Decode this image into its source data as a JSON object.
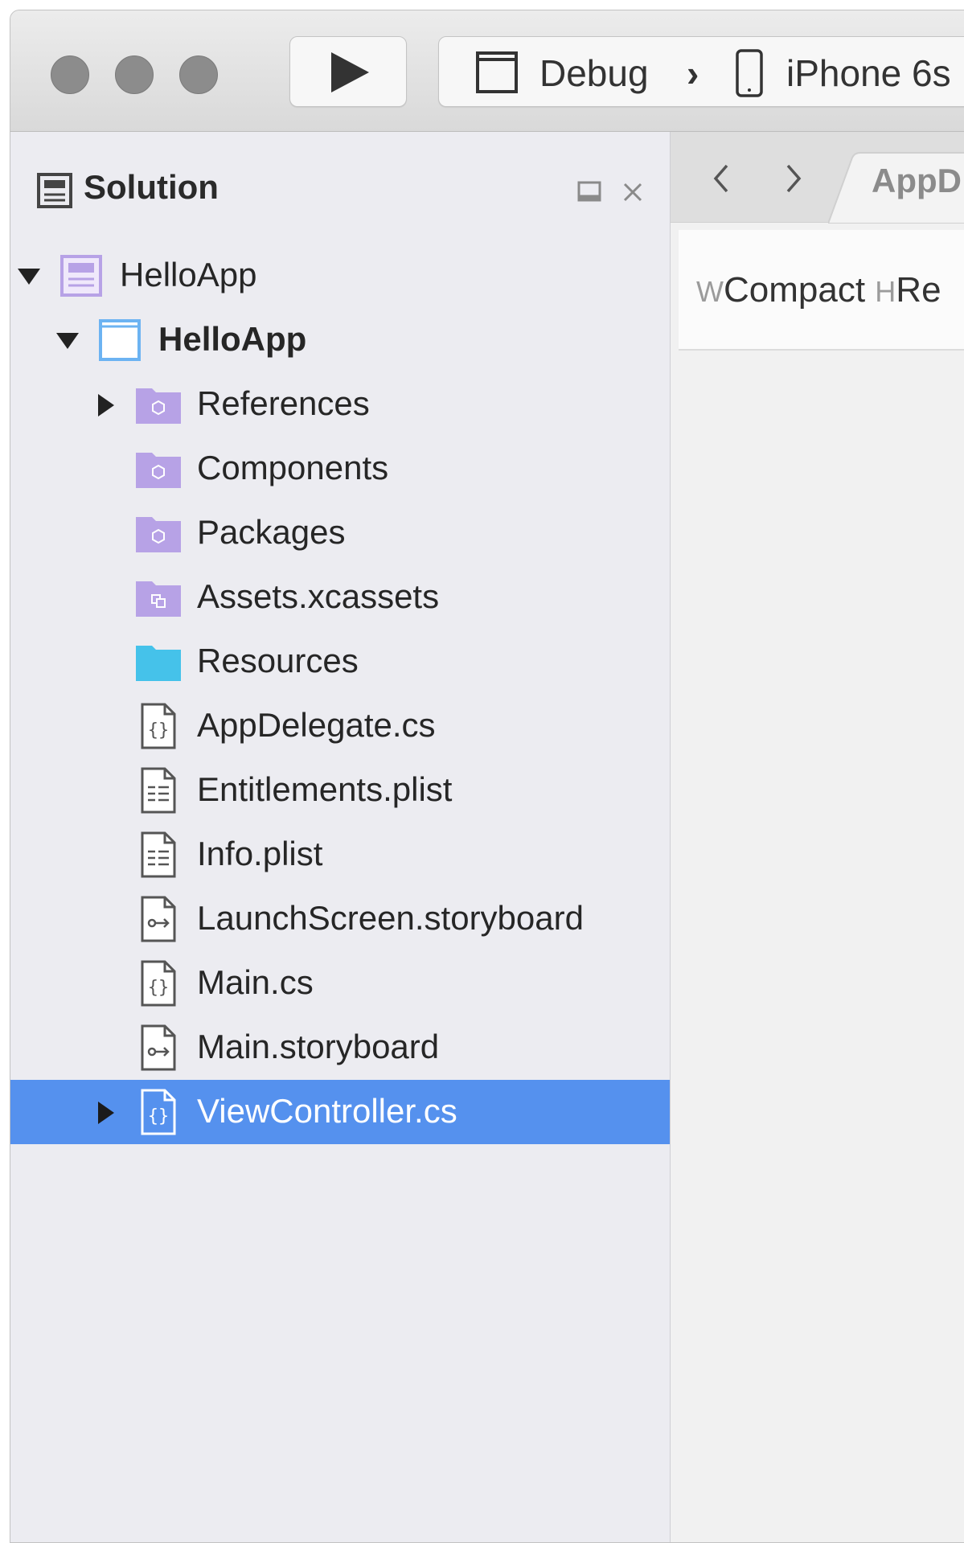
{
  "toolbar": {
    "configuration": "Debug",
    "separator": "›",
    "device": "iPhone 6s"
  },
  "solution_pad": {
    "title": "Solution",
    "tree": [
      {
        "label": "HelloApp",
        "kind": "solution",
        "expanded": true
      },
      {
        "label": "HelloApp",
        "kind": "project",
        "expanded": true,
        "bold": true
      },
      {
        "label": "References",
        "kind": "folder-purple",
        "expandable": true
      },
      {
        "label": "Components",
        "kind": "folder-purple"
      },
      {
        "label": "Packages",
        "kind": "folder-purple"
      },
      {
        "label": "Assets.xcassets",
        "kind": "folder-assets"
      },
      {
        "label": "Resources",
        "kind": "folder-blue"
      },
      {
        "label": "AppDelegate.cs",
        "kind": "cs-file"
      },
      {
        "label": "Entitlements.plist",
        "kind": "plist-file"
      },
      {
        "label": "Info.plist",
        "kind": "plist-file"
      },
      {
        "label": "LaunchScreen.storyboard",
        "kind": "storyboard-file"
      },
      {
        "label": "Main.cs",
        "kind": "cs-file"
      },
      {
        "label": "Main.storyboard",
        "kind": "storyboard-file"
      },
      {
        "label": "ViewController.cs",
        "kind": "cs-file",
        "expandable": true,
        "selected": true
      }
    ]
  },
  "editor": {
    "tab_label": "AppD",
    "size_class": {
      "w_prefix": "W",
      "w_value": "Compact",
      "h_prefix": "H",
      "h_value": "Re"
    }
  },
  "colors": {
    "selection": "#5591ee",
    "folder_purple": "#b7a2e6",
    "folder_blue": "#45c2ea"
  }
}
